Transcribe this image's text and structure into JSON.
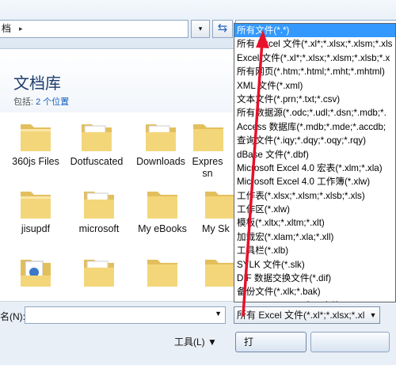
{
  "address": {
    "text": "档",
    "arrow": "▸"
  },
  "library": {
    "title": "文档库",
    "includes_label": "包括:",
    "locations_link": "2 个位置"
  },
  "items": [
    {
      "label": "360js Files",
      "type": "folder"
    },
    {
      "label": "Dotfuscated",
      "type": "folder"
    },
    {
      "label": "Downloads",
      "type": "folder"
    },
    {
      "label": "Expressn",
      "type": "folder"
    },
    {
      "label": "jisupdf",
      "type": "folder"
    },
    {
      "label": "microsoft",
      "type": "folder"
    },
    {
      "label": "My eBooks",
      "type": "folder"
    },
    {
      "label": "My Sk",
      "type": "folder"
    },
    {
      "label": "",
      "type": "folder-doc"
    },
    {
      "label": "",
      "type": "folder"
    },
    {
      "label": "",
      "type": "folder"
    },
    {
      "label": "",
      "type": "folder"
    }
  ],
  "filename": {
    "label": "名(N):",
    "value": ""
  },
  "filetype": {
    "selected": "所有 Excel 文件(*.xl*;*.xlsx;*.xl"
  },
  "buttons": {
    "tools": "工具(L)",
    "open": "打"
  },
  "dropdown": {
    "options": [
      "所有文件(*.*)",
      "所有 Excel 文件(*.xl*;*.xlsx;*.xlsm;*.xls",
      "Excel 文件(*.xl*;*.xlsx;*.xlsm;*.xlsb;*.x",
      "所有网页(*.htm;*.html;*.mht;*.mhtml)",
      "XML 文件(*.xml)",
      "文本文件(*.prn;*.txt;*.csv)",
      "所有数据源(*.odc;*.udl;*.dsn;*.mdb;*.",
      "Access 数据库(*.mdb;*.mde;*.accdb;",
      "查询文件(*.iqy;*.dqy;*.oqy;*.rqy)",
      "dBase 文件(*.dbf)",
      "Microsoft Excel 4.0 宏表(*.xlm;*.xla)",
      "Microsoft Excel 4.0 工作簿(*.xlw)",
      "工作表(*.xlsx;*.xlsm;*.xlsb;*.xls)",
      "工作区(*.xlw)",
      "模板(*.xltx;*.xltm;*.xlt)",
      "加载宏(*.xlam;*.xla;*.xll)",
      "工具栏(*.xlb)",
      "SYLK 文件(*.slk)",
      "DIF 数据交换文件(*.dif)",
      "备份文件(*.xlk;*.bak)",
      "OpenDocument 电子表格(*.ods)"
    ],
    "selected_index": 0
  },
  "colors": {
    "selection": "#3399ff",
    "annotation_arrow": "#e8102a",
    "folder": "#f3d77e"
  }
}
